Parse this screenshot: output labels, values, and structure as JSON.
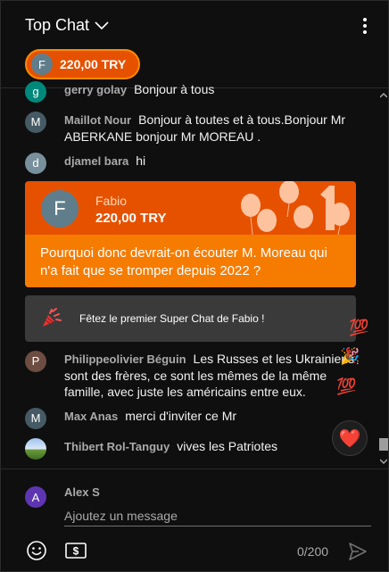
{
  "header": {
    "title": "Top Chat",
    "dropdown_icon": "chevron-down-icon",
    "menu_icon": "more-vert-icon"
  },
  "ticker": {
    "avatar_letter": "F",
    "amount": "220,00 TRY"
  },
  "messages": [
    {
      "avatar": "g",
      "avatar_color": "#00897b",
      "author": "gerry golay",
      "text": "Bonjour à tous"
    },
    {
      "avatar": "M",
      "avatar_color": "#455a64",
      "author": "Maillot Nour",
      "text": "Bonjour à toutes et à tous.Bonjour Mr ABERKANE bonjour Mr MOREAU ."
    },
    {
      "avatar": "d",
      "avatar_color": "#78909c",
      "author": "djamel bara",
      "text": "hi"
    }
  ],
  "superchat": {
    "avatar_letter": "F",
    "name": "Fabio",
    "amount": "220,00 TRY",
    "text": "Pourquoi donc devrait-on écouter M. Moreau qui n'a fait que se tromper depuis 2022 ?",
    "header_color": "#e65100",
    "body_color": "#f57c00"
  },
  "celebrate": {
    "icon": "party-popper-icon",
    "text": "Fêtez le premier Super Chat de Fabio !"
  },
  "messages_after": [
    {
      "avatar": "P",
      "avatar_color": "#6d4c41",
      "author": "Philippeolivier Béguin",
      "text": "Les Russes et les Ukrainiens sont des frères, ce sont les mêmes de la même famille, avec juste les américains entre eux."
    },
    {
      "avatar": "M",
      "avatar_color": "#455a64",
      "author": "Max Anas",
      "text": "merci d'inviter ce Mr"
    },
    {
      "avatar": "photo",
      "avatar_color": "#4a7ab0",
      "author": "Thibert Rol-Tanguy",
      "text": "vives les Patriotes"
    }
  ],
  "reactions": {
    "hundred": "💯",
    "party": "🎉",
    "heart": "❤️"
  },
  "composer": {
    "avatar_letter": "A",
    "user_name": "Alex S",
    "placeholder": "Ajoutez un message",
    "counter": "0/200",
    "emoji_icon": "emoji-icon",
    "money_icon": "super-chat-money-icon",
    "send_icon": "send-icon"
  }
}
